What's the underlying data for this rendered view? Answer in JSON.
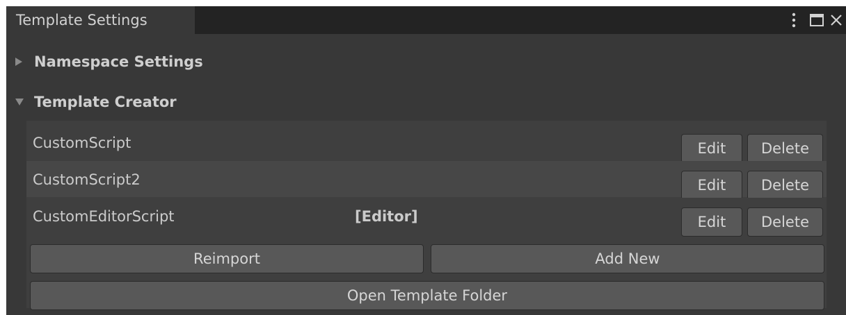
{
  "window": {
    "tab_title": "Template Settings",
    "controls": {
      "menu_icon": "kebab-menu-icon",
      "maximize_icon": "maximize-icon",
      "close_icon": "close-icon"
    }
  },
  "sections": {
    "namespace": {
      "label": "Namespace Settings",
      "expanded": false
    },
    "creator": {
      "label": "Template Creator",
      "expanded": true
    }
  },
  "templates": [
    {
      "name": "CustomScript",
      "tag": "",
      "edit_label": "Edit",
      "delete_label": "Delete"
    },
    {
      "name": "CustomScript2",
      "tag": "",
      "edit_label": "Edit",
      "delete_label": "Delete"
    },
    {
      "name": "CustomEditorScript",
      "tag": "[Editor]",
      "edit_label": "Edit",
      "delete_label": "Delete"
    }
  ],
  "actions": {
    "reimport": "Reimport",
    "add_new": "Add New",
    "open_folder": "Open Template Folder"
  }
}
